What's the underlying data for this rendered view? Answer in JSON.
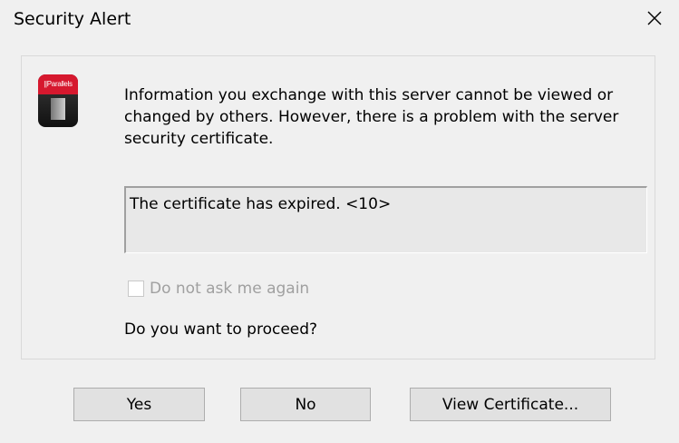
{
  "window": {
    "title": "Security Alert",
    "close_icon": "close-icon"
  },
  "app_icon": {
    "name": "parallels-app-icon",
    "brand_text": "||Parallels",
    "brand_color": "#d6182e"
  },
  "message": {
    "text": "Information you exchange with this server cannot be viewed or changed by others. However, there is a problem with the server security certificate."
  },
  "details": {
    "text": "The certificate has expired. <10>"
  },
  "checkbox": {
    "label": "Do not ask me again",
    "checked": false,
    "enabled": false
  },
  "question": "Do you want to proceed?",
  "buttons": {
    "yes": "Yes",
    "no": "No",
    "view_certificate": "View Certificate..."
  }
}
